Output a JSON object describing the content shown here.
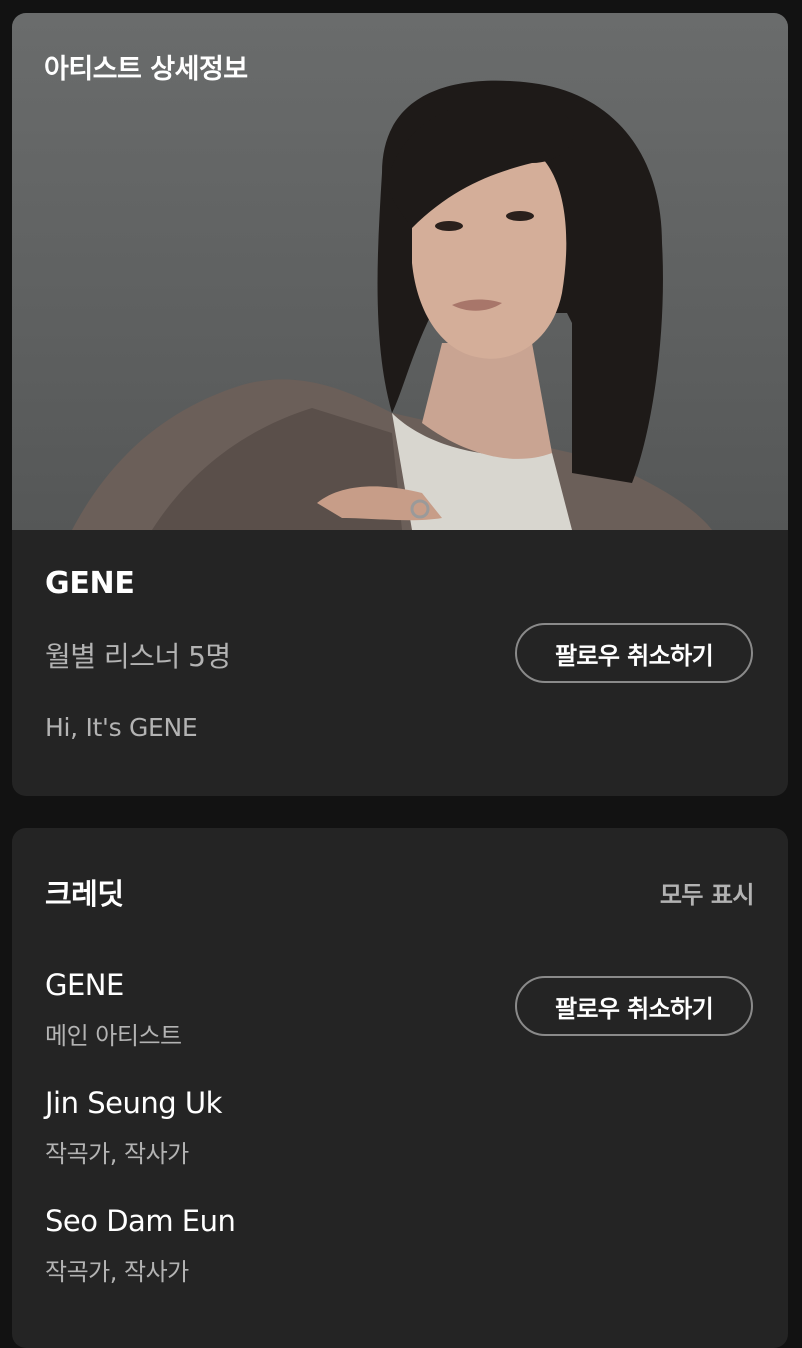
{
  "artist_card": {
    "title": "아티스트 상세정보",
    "name": "GENE",
    "monthly_listeners": "월별 리스너 5명",
    "follow_button": "팔로우 취소하기",
    "bio": "Hi, It's GENE"
  },
  "credits": {
    "title": "크레딧",
    "show_all": "모두 표시",
    "follow_button": "팔로우 취소하기",
    "items": [
      {
        "name": "GENE",
        "role": "메인 아티스트"
      },
      {
        "name": "Jin Seung Uk",
        "role": "작곡가, 작사가"
      },
      {
        "name": "Seo Dam Eun",
        "role": "작곡가, 작사가"
      }
    ]
  },
  "colors": {
    "background": "#121212",
    "card": "#242424",
    "secondary_text": "#b3b3b3",
    "button_border": "#8a8a8a"
  }
}
